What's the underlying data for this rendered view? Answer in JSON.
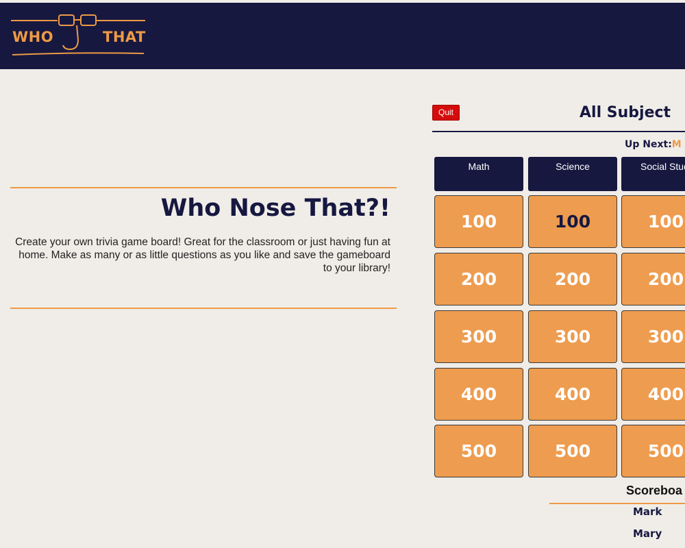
{
  "brand": {
    "word_left": "WHO",
    "word_right": "THAT"
  },
  "hero": {
    "title": "Who Nose That?!",
    "description": "Create your own trivia game board! Great for the classroom or just having fun at home. Make as many or as little questions as you like and save the gameboard to your library!"
  },
  "board": {
    "quit_label": "Quit",
    "title": "All Subject",
    "up_next_label": "Up Next:",
    "up_next_name": "M",
    "categories": [
      "Math",
      "Science",
      "Social Studi"
    ],
    "rows": [
      [
        "100",
        "100",
        "100"
      ],
      [
        "200",
        "200",
        "200"
      ],
      [
        "300",
        "300",
        "300"
      ],
      [
        "400",
        "400",
        "400"
      ],
      [
        "500",
        "500",
        "500"
      ]
    ]
  },
  "scoreboard": {
    "title": "Scoreboa",
    "players": [
      "Mark",
      "Mary"
    ]
  },
  "colors": {
    "navy": "#161840",
    "orange": "#ee9c4f",
    "quit_red": "#d40c0c",
    "background": "#f0ede8"
  }
}
